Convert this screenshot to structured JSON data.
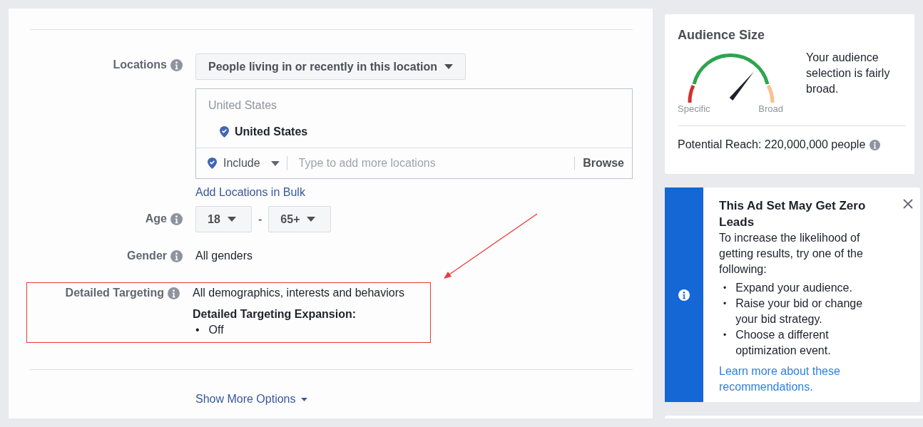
{
  "targeting": {
    "locations": {
      "label": "Locations",
      "mode": "People living in or recently in this location",
      "group_heading": "United States",
      "selected": [
        {
          "name": "United States"
        }
      ],
      "include_mode": "Include",
      "placeholder": "Type to add more locations",
      "browse": "Browse",
      "bulk_link": "Add Locations in Bulk"
    },
    "age": {
      "label": "Age",
      "min": "18",
      "separator": "-",
      "max": "65+"
    },
    "gender": {
      "label": "Gender",
      "value": "All genders"
    },
    "detailed": {
      "label": "Detailed Targeting",
      "value": "All demographics, interests and behaviors",
      "expansion_heading": "Detailed Targeting Expansion:",
      "expansion_items": [
        {
          "marker": "•",
          "text": "Off"
        }
      ]
    },
    "show_more": "Show More Options"
  },
  "audience_size": {
    "title": "Audience Size",
    "left_label": "Specific",
    "right_label": "Broad",
    "description": "Your audience selection is fairly broad.",
    "reach": "Potential Reach: 220,000,000 people"
  },
  "alert": {
    "title": "This Ad Set May Get Zero Leads",
    "text": "To increase the likelihood of getting results, try one of the following:",
    "items": [
      {
        "marker": "•",
        "text": "Expand your audience."
      },
      {
        "marker": "•",
        "text": "Raise your bid or change your bid strategy."
      },
      {
        "marker": "•",
        "text": "Choose a different optimization event."
      }
    ],
    "link": "Learn more about these recommendations."
  }
}
